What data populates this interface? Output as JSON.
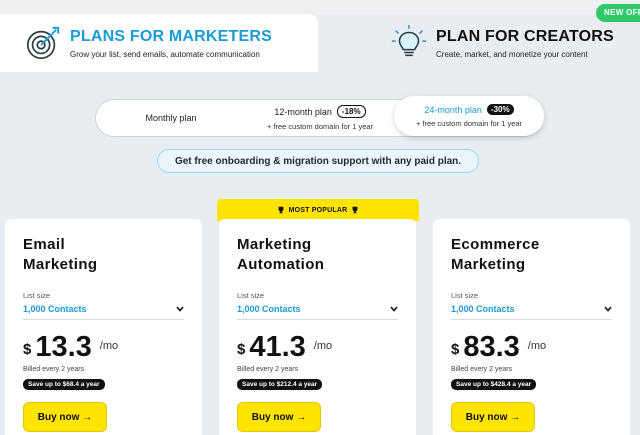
{
  "audience_tabs": {
    "marketers": {
      "title": "PLANS FOR MARKETERS",
      "subtitle": "Grow your list, send emails, automate communication",
      "icon": "target-icon"
    },
    "creators": {
      "title": "PLAN FOR CREATORS",
      "subtitle": "Create, market, and monetize your content",
      "icon": "lightbulb-icon"
    },
    "new_badge": "NEW OFF"
  },
  "billing": {
    "monthly": {
      "label": "Monthly plan"
    },
    "twelve": {
      "label": "12-month plan",
      "discount": "-18%",
      "note": "+ free custom domain for 1 year"
    },
    "twentyfour": {
      "label": "24-month plan",
      "discount": "-30%",
      "note": "+ free custom domain for 1 year"
    },
    "selected": "24-month plan"
  },
  "onboarding_banner": "Get free onboarding & migration support with any paid plan.",
  "most_popular": "MOST POPULAR",
  "plans": [
    {
      "title_line1": "Email",
      "title_line2": "Marketing",
      "list_size_label": "List size",
      "list_size_value": "1,000 Contacts",
      "currency": "$",
      "price": "13.3",
      "per": "/mo",
      "billed": "Billed every 2 years",
      "save": "Save up to $68.4 a year",
      "buy_label": "Buy now →"
    },
    {
      "title_line1": "Marketing",
      "title_line2": "Automation",
      "list_size_label": "List size",
      "list_size_value": "1,000 Contacts",
      "currency": "$",
      "price": "41.3",
      "per": "/mo",
      "billed": "Billed every 2 years",
      "save": "Save up to $212.4 a year",
      "buy_label": "Buy now →"
    },
    {
      "title_line1": "Ecommerce",
      "title_line2": "Marketing",
      "list_size_label": "List size",
      "list_size_value": "1,000 Contacts",
      "currency": "$",
      "price": "83.3",
      "per": "/mo",
      "billed": "Billed every 2 years",
      "save": "Save up to $428.4 a year",
      "buy_label": "Buy now →"
    }
  ],
  "colors": {
    "accent_blue": "#1a9bd7",
    "cta_yellow": "#ffe400",
    "new_green": "#2fc96a",
    "background": "#e8edf2"
  }
}
